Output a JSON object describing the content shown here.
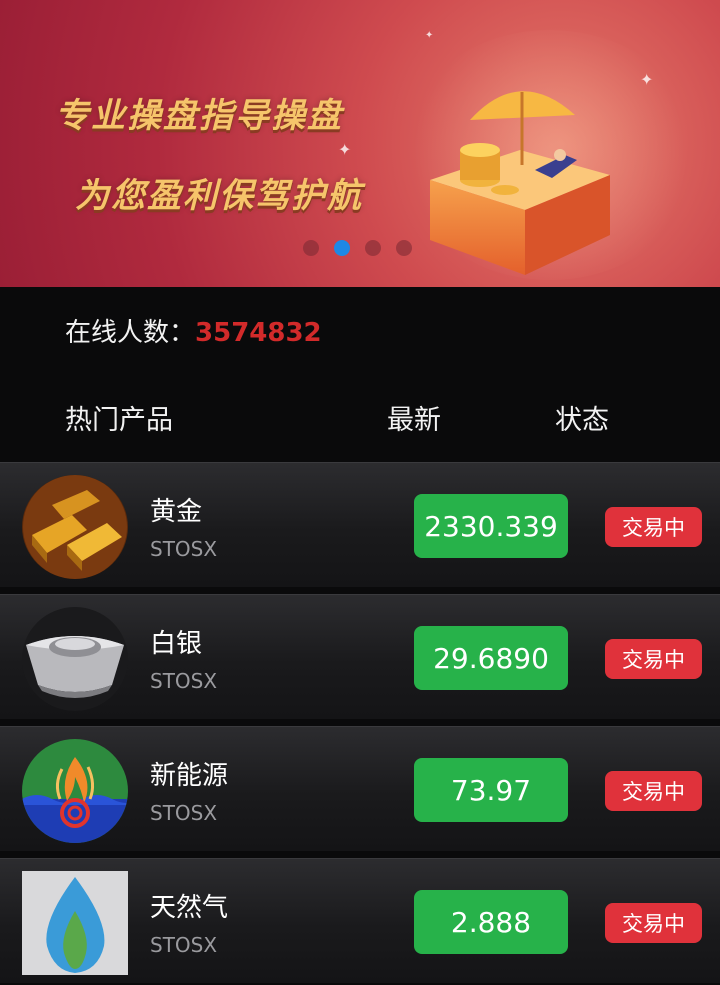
{
  "banner": {
    "slogan_line1": "专业操盘指导操盘",
    "slogan_line2": "为您盈利保驾护航",
    "carousel_dots": 4,
    "active_dot": 2
  },
  "online": {
    "label": "在线人数：",
    "count": "3574832",
    "count_color": "#d22a2a"
  },
  "table_header": {
    "name": "热门产品",
    "latest": "最新",
    "status": "状态"
  },
  "products": [
    {
      "name": "黄金",
      "code": "STOSX",
      "price": "2330.339",
      "status": "交易中",
      "icon": "gold-bars-icon"
    },
    {
      "name": "白银",
      "code": "STOSX",
      "price": "29.6890",
      "status": "交易中",
      "icon": "silver-ingot-icon"
    },
    {
      "name": "新能源",
      "code": "STOSX",
      "price": "73.97",
      "status": "交易中",
      "icon": "new-energy-icon"
    },
    {
      "name": "天然气",
      "code": "STOSX",
      "price": "2.888",
      "status": "交易中",
      "icon": "natural-gas-flame-icon"
    }
  ],
  "colors": {
    "price_bg": "#27b24a",
    "status_bg": "#e0323b",
    "accent_blue": "#1e88e5"
  }
}
